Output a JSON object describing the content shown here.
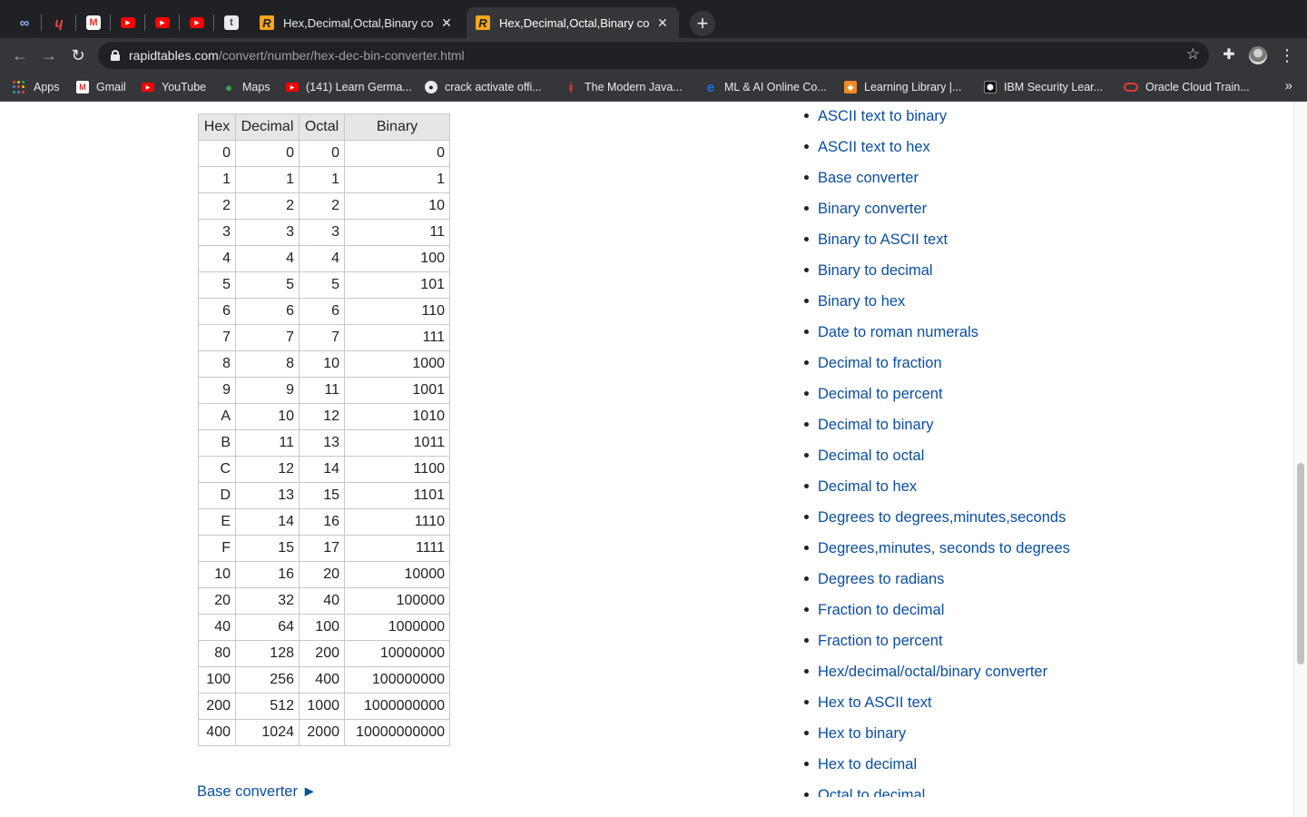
{
  "browser": {
    "tabs": [
      {
        "title": "Hex,Decimal,Octal,Binary conv",
        "active": false
      },
      {
        "title": "Hex,Decimal,Octal,Binary conv",
        "active": true
      }
    ],
    "pinned_tabs": [
      "infinity-icon",
      "scribble-icon",
      "gmail-icon",
      "youtube-icon",
      "youtube-icon",
      "youtube-icon",
      "tumblr-icon"
    ],
    "url_host": "rapidtables.com",
    "url_path": "/convert/number/hex-dec-bin-converter.html"
  },
  "bookmarks": [
    {
      "label": "Apps",
      "icon": "apps-grid-icon"
    },
    {
      "label": "Gmail",
      "icon": "gmail-icon"
    },
    {
      "label": "YouTube",
      "icon": "youtube-icon"
    },
    {
      "label": "Maps",
      "icon": "maps-pin-icon"
    },
    {
      "label": "(141) Learn Germa...",
      "icon": "youtube-icon"
    },
    {
      "label": "crack activate offi...",
      "icon": "github-icon"
    },
    {
      "label": "The Modern Java...",
      "icon": "figure-icon"
    },
    {
      "label": "ML & AI Online Co...",
      "icon": "edureka-icon"
    },
    {
      "label": "Learning Library |...",
      "icon": "cube-icon"
    },
    {
      "label": "IBM Security Lear...",
      "icon": "shield-icon"
    },
    {
      "label": "Oracle Cloud Train...",
      "icon": "oracle-icon"
    }
  ],
  "table": {
    "headers": [
      "Hex",
      "Decimal",
      "Octal",
      "Binary"
    ],
    "rows": [
      [
        "0",
        "0",
        "0",
        "0"
      ],
      [
        "1",
        "1",
        "1",
        "1"
      ],
      [
        "2",
        "2",
        "2",
        "10"
      ],
      [
        "3",
        "3",
        "3",
        "11"
      ],
      [
        "4",
        "4",
        "4",
        "100"
      ],
      [
        "5",
        "5",
        "5",
        "101"
      ],
      [
        "6",
        "6",
        "6",
        "110"
      ],
      [
        "7",
        "7",
        "7",
        "111"
      ],
      [
        "8",
        "8",
        "10",
        "1000"
      ],
      [
        "9",
        "9",
        "11",
        "1001"
      ],
      [
        "A",
        "10",
        "12",
        "1010"
      ],
      [
        "B",
        "11",
        "13",
        "1011"
      ],
      [
        "C",
        "12",
        "14",
        "1100"
      ],
      [
        "D",
        "13",
        "15",
        "1101"
      ],
      [
        "E",
        "14",
        "16",
        "1110"
      ],
      [
        "F",
        "15",
        "17",
        "1111"
      ],
      [
        "10",
        "16",
        "20",
        "10000"
      ],
      [
        "20",
        "32",
        "40",
        "100000"
      ],
      [
        "40",
        "64",
        "100",
        "1000000"
      ],
      [
        "80",
        "128",
        "200",
        "10000000"
      ],
      [
        "100",
        "256",
        "400",
        "100000000"
      ],
      [
        "200",
        "512",
        "1000",
        "1000000000"
      ],
      [
        "400",
        "1024",
        "2000",
        "10000000000"
      ]
    ]
  },
  "prev_link": "Base converter ►",
  "related_links": [
    "ASCII text to binary",
    "ASCII text to hex",
    "Base converter",
    "Binary converter",
    "Binary to ASCII text",
    "Binary to decimal",
    "Binary to hex",
    "Date to roman numerals",
    "Decimal to fraction",
    "Decimal to percent",
    "Decimal to binary",
    "Decimal to octal",
    "Decimal to hex",
    "Degrees to degrees,minutes,seconds",
    "Degrees,minutes, seconds to degrees",
    "Degrees to radians",
    "Fraction to decimal",
    "Fraction to percent",
    "Hex/decimal/octal/binary converter",
    "Hex to ASCII text",
    "Hex to binary",
    "Hex to decimal",
    "Octal to decimal"
  ],
  "colors": {
    "link": "#0b4ea2",
    "tabstrip": "#202124",
    "toolbar": "#35363a"
  }
}
